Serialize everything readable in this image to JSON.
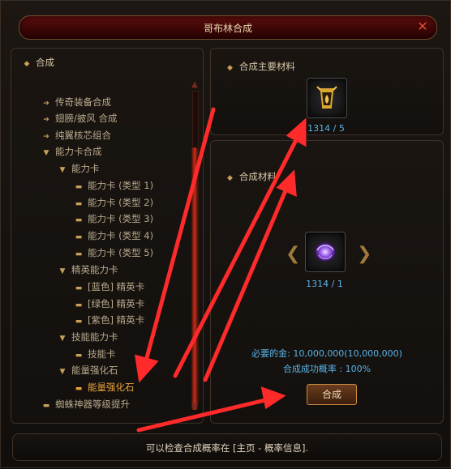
{
  "window": {
    "title": "哥布林合成",
    "close_glyph": "✕"
  },
  "tree": {
    "root": "合成",
    "items": [
      {
        "label": "传奇装备合成"
      },
      {
        "label": "翅膀/披风 合成"
      },
      {
        "label": "纯翼核芯组合"
      },
      {
        "label": "能力卡合成"
      },
      {
        "label": "能力卡"
      },
      {
        "label": "能力卡 (类型 1)"
      },
      {
        "label": "能力卡 (类型 2)"
      },
      {
        "label": "能力卡 (类型 3)"
      },
      {
        "label": "能力卡 (类型 4)"
      },
      {
        "label": "能力卡 (类型 5)"
      },
      {
        "label": "精英能力卡"
      },
      {
        "label": "[蓝色] 精英卡"
      },
      {
        "label": "[绿色] 精英卡"
      },
      {
        "label": "[紫色] 精英卡"
      },
      {
        "label": "技能能力卡"
      },
      {
        "label": "技能卡"
      },
      {
        "label": "能量强化石"
      },
      {
        "label": "能量强化石"
      },
      {
        "label": "蜘蛛神器等级提升"
      }
    ],
    "selected_index": 17
  },
  "main_material": {
    "label": "合成主要材料",
    "count": "1314 / 5",
    "icon": "gold-trophy-icon"
  },
  "materials": {
    "label": "合成材料",
    "count": "1314 / 1",
    "icon": "purple-crystal-icon"
  },
  "info": {
    "gold_required": "必要的金: 10,000,000(10,000,000)",
    "success_rate": "合成成功概率 : 100%"
  },
  "combine_button": "合成",
  "status": "可以检查合成概率在 [主页 - 概率信息].",
  "colors": {
    "accent": "#e8a13a",
    "count_blue": "#5ab4e8",
    "arrow_red": "#ff2a2a"
  }
}
